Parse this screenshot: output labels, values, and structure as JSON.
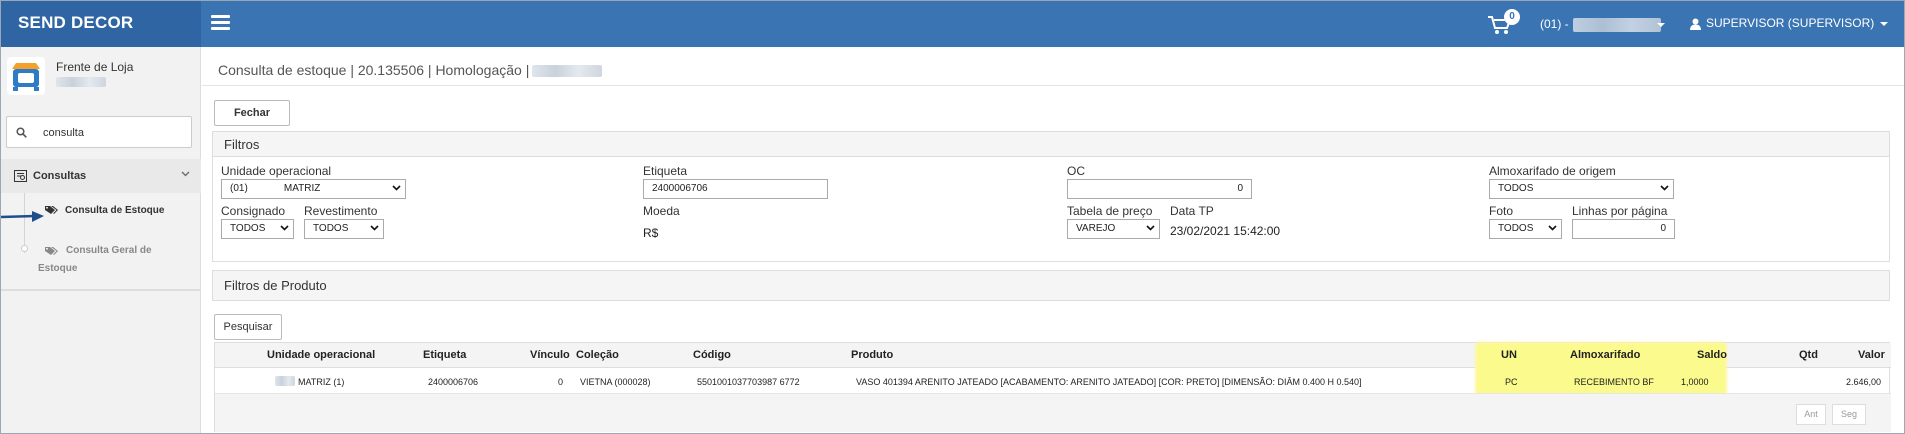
{
  "topbar": {
    "brand": "SEND DECOR",
    "cart_count": "0",
    "company_prefix": "(01) -",
    "user": "SUPERVISOR (SUPERVISOR)"
  },
  "sidebar": {
    "profile_name": "Frente de Loja",
    "search_value": "consulta",
    "group_label": "Consultas",
    "items": [
      {
        "label": "Consulta de Estoque"
      },
      {
        "label": "Consulta Geral de Estoque"
      }
    ]
  },
  "main": {
    "page_title": "Consulta de estoque | 20.135506 | Homologação |",
    "close_button": "Fechar",
    "filters_title": "Filtros",
    "filters": {
      "unidade_label": "Unidade operacional",
      "unidade_value": "(01)             MATRIZ",
      "etiqueta_label": "Etiqueta",
      "etiqueta_value": "2400006706",
      "oc_label": "OC",
      "oc_value": "0",
      "almox_label": "Almoxarifado de origem",
      "almox_value": "TODOS",
      "consignado_label": "Consignado",
      "consignado_value": "TODOS",
      "revestimento_label": "Revestimento",
      "revestimento_value": "TODOS",
      "moeda_label": "Moeda",
      "moeda_value": "R$",
      "tabela_label": "Tabela de preço",
      "tabela_value": "VAREJO",
      "datatp_label": "Data TP",
      "datatp_value": "23/02/2021 15:42:00",
      "foto_label": "Foto",
      "foto_value": "TODOS",
      "linhas_label": "Linhas por página",
      "linhas_value": "0"
    },
    "product_filters_title": "Filtros de Produto",
    "search_button": "Pesquisar",
    "table": {
      "headers": {
        "unidade": "Unidade operacional",
        "etiqueta": "Etiqueta",
        "vinculo": "Vínculo",
        "colecao": "Coleção",
        "codigo": "Código",
        "produto": "Produto",
        "un": "UN",
        "almoxarifado": "Almoxarifado",
        "saldo": "Saldo",
        "qtd": "Qtd",
        "valor": "Valor"
      },
      "rows": [
        {
          "unidade": "MATRIZ (1)",
          "etiqueta": "2400006706",
          "vinculo": "0",
          "colecao": "VIETNA (000028)",
          "codigo": "5501001037703987 6772",
          "produto": "VASO 401394 ARENITO JATEADO [ACABAMENTO: ARENITO JATEADO] [COR: PRETO] [DIMENSÃO: DIÂM 0.400 H 0.540]",
          "un": "PC",
          "almoxarifado": "RECEBIMENTO BF",
          "saldo": "1,0000",
          "valor": "2.646,00"
        }
      ],
      "pager_prev": "Ant",
      "pager_next": "Seg"
    }
  },
  "colors": {
    "topbar": "#3a74b3",
    "brand_bg": "#2f65a3",
    "highlight": "#fbfa8c"
  }
}
